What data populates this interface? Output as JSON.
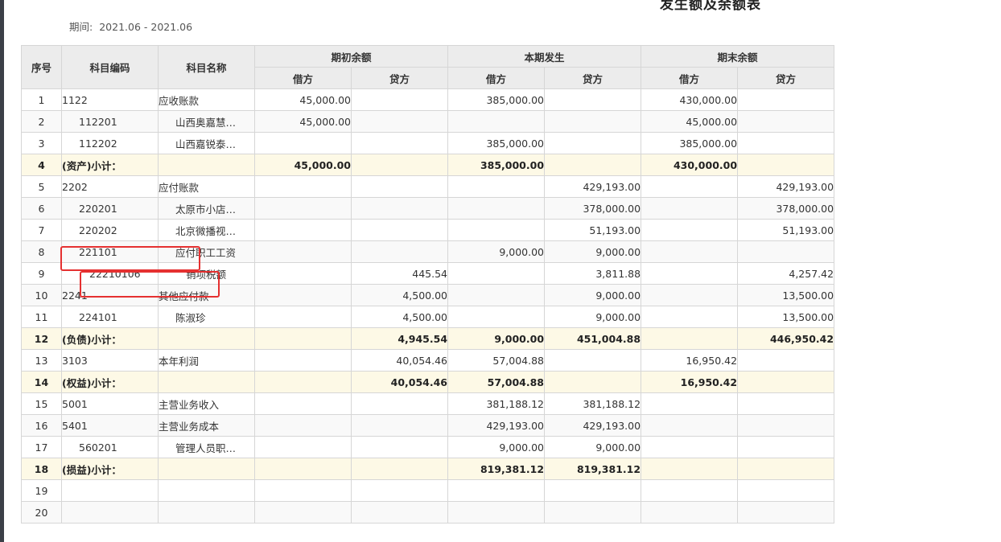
{
  "report": {
    "title": "发生额及余额表",
    "period_label": "期间:",
    "period_value": "2021.06 - 2021.06"
  },
  "table": {
    "headers": {
      "seq": "序号",
      "code": "科目编码",
      "name": "科目名称",
      "opening": "期初余额",
      "current": "本期发生",
      "closing": "期末余额",
      "debit": "借方",
      "credit": "贷方"
    },
    "rows": [
      {
        "seq": "1",
        "code": "1122",
        "name": "应收账款",
        "level": 1,
        "subtotal": false,
        "values": [
          "45,000.00",
          "",
          "385,000.00",
          "",
          "430,000.00",
          ""
        ]
      },
      {
        "seq": "2",
        "code": "112201",
        "name": "山西奥嘉慧…",
        "level": 2,
        "subtotal": false,
        "values": [
          "45,000.00",
          "",
          "",
          "",
          "45,000.00",
          ""
        ]
      },
      {
        "seq": "3",
        "code": "112202",
        "name": "山西嘉锐泰…",
        "level": 2,
        "subtotal": false,
        "values": [
          "",
          "",
          "385,000.00",
          "",
          "385,000.00",
          ""
        ]
      },
      {
        "seq": "4",
        "code": "(资产)小计：",
        "name": "",
        "level": 1,
        "subtotal": true,
        "values": [
          "45,000.00",
          "",
          "385,000.00",
          "",
          "430,000.00",
          ""
        ]
      },
      {
        "seq": "5",
        "code": "2202",
        "name": "应付账款",
        "level": 1,
        "subtotal": false,
        "values": [
          "",
          "",
          "",
          "429,193.00",
          "",
          "429,193.00"
        ]
      },
      {
        "seq": "6",
        "code": "220201",
        "name": "太原市小店…",
        "level": 2,
        "subtotal": false,
        "values": [
          "",
          "",
          "",
          "378,000.00",
          "",
          "378,000.00"
        ]
      },
      {
        "seq": "7",
        "code": "220202",
        "name": "北京微播视…",
        "level": 2,
        "subtotal": false,
        "values": [
          "",
          "",
          "",
          "51,193.00",
          "",
          "51,193.00"
        ]
      },
      {
        "seq": "8",
        "code": "221101",
        "name": "应付职工工资",
        "level": 2,
        "subtotal": false,
        "values": [
          "",
          "",
          "9,000.00",
          "9,000.00",
          "",
          ""
        ]
      },
      {
        "seq": "9",
        "code": "22210106",
        "name": "销项税额",
        "level": 3,
        "subtotal": false,
        "values": [
          "",
          "445.54",
          "",
          "3,811.88",
          "",
          "4,257.42"
        ]
      },
      {
        "seq": "10",
        "code": "2241",
        "name": "其他应付款",
        "level": 1,
        "subtotal": false,
        "values": [
          "",
          "4,500.00",
          "",
          "9,000.00",
          "",
          "13,500.00"
        ]
      },
      {
        "seq": "11",
        "code": "224101",
        "name": "陈淑珍",
        "level": 2,
        "subtotal": false,
        "values": [
          "",
          "4,500.00",
          "",
          "9,000.00",
          "",
          "13,500.00"
        ]
      },
      {
        "seq": "12",
        "code": "(负债)小计：",
        "name": "",
        "level": 1,
        "subtotal": true,
        "values": [
          "",
          "4,945.54",
          "9,000.00",
          "451,004.88",
          "",
          "446,950.42"
        ]
      },
      {
        "seq": "13",
        "code": "3103",
        "name": "本年利润",
        "level": 1,
        "subtotal": false,
        "values": [
          "",
          "40,054.46",
          "57,004.88",
          "",
          "16,950.42",
          ""
        ]
      },
      {
        "seq": "14",
        "code": "(权益)小计：",
        "name": "",
        "level": 1,
        "subtotal": true,
        "values": [
          "",
          "40,054.46",
          "57,004.88",
          "",
          "16,950.42",
          ""
        ]
      },
      {
        "seq": "15",
        "code": "5001",
        "name": "主营业务收入",
        "level": 1,
        "subtotal": false,
        "values": [
          "",
          "",
          "381,188.12",
          "381,188.12",
          "",
          ""
        ]
      },
      {
        "seq": "16",
        "code": "5401",
        "name": "主营业务成本",
        "level": 1,
        "subtotal": false,
        "values": [
          "",
          "",
          "429,193.00",
          "429,193.00",
          "",
          ""
        ]
      },
      {
        "seq": "17",
        "code": "560201",
        "name": "管理人员职…",
        "level": 2,
        "subtotal": false,
        "values": [
          "",
          "",
          "9,000.00",
          "9,000.00",
          "",
          ""
        ]
      },
      {
        "seq": "18",
        "code": "(损益)小计：",
        "name": "",
        "level": 1,
        "subtotal": true,
        "values": [
          "",
          "",
          "819,381.12",
          "819,381.12",
          "",
          ""
        ]
      },
      {
        "seq": "19",
        "code": "",
        "name": "",
        "level": 1,
        "subtotal": false,
        "values": [
          "",
          "",
          "",
          "",
          "",
          ""
        ]
      },
      {
        "seq": "20",
        "code": "",
        "name": "",
        "level": 1,
        "subtotal": false,
        "values": [
          "",
          "",
          "",
          "",
          "",
          ""
        ]
      }
    ]
  },
  "colors": {
    "amount_link": "#3f7fd9",
    "subtotal_bg": "#fdf9e6",
    "header_bg": "#ececec",
    "highlight_box": "#e53030"
  }
}
